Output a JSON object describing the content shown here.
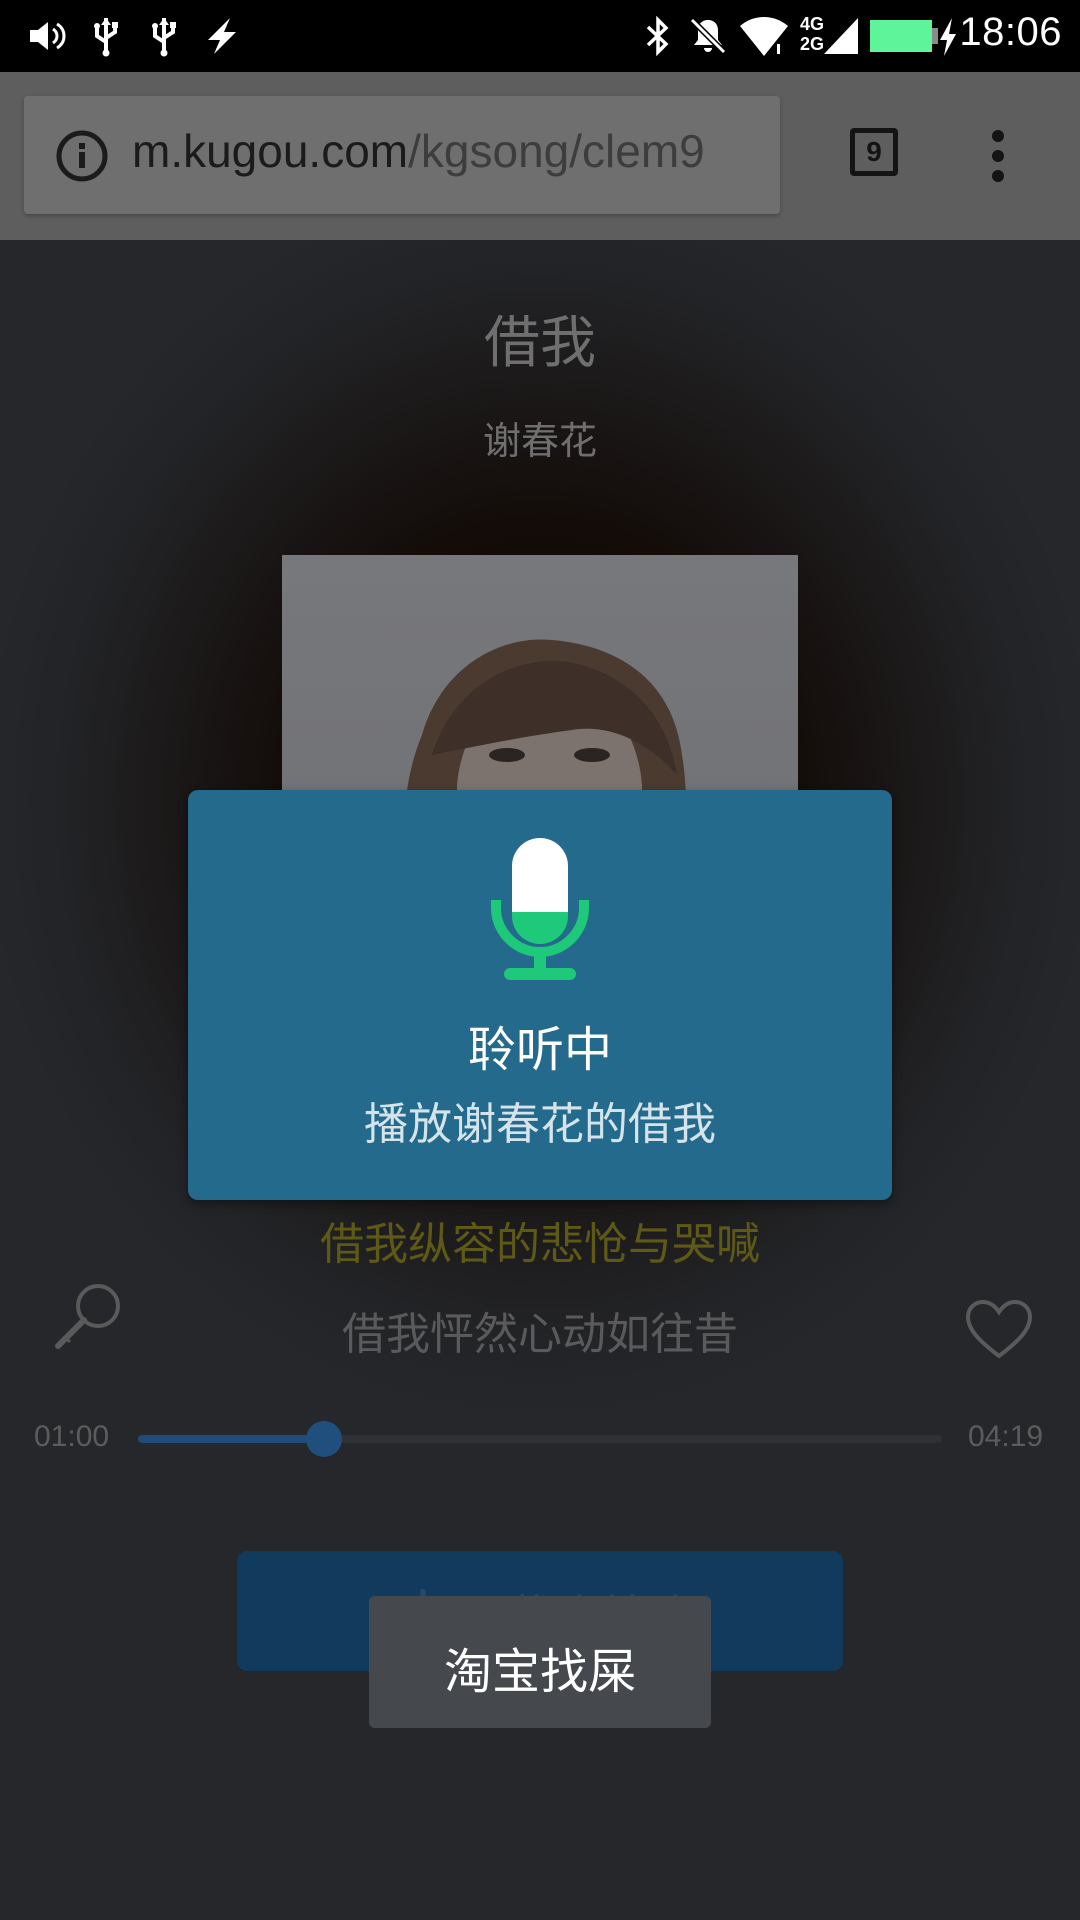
{
  "status_bar": {
    "left_icons": [
      "volume-icon",
      "usb-icon",
      "usb-icon",
      "flash-icon"
    ],
    "right_icons": [
      "bluetooth-icon",
      "notifications-off-icon",
      "wifi-icon",
      "signal-4g-2g-icon",
      "battery-charging-icon"
    ],
    "network_label_top": "4G",
    "network_label_bottom": "2G",
    "time": "18:06"
  },
  "browser": {
    "url_host": "m.kugou.com",
    "url_path": "/kgsong/clem9",
    "tab_count": "9"
  },
  "song": {
    "title": "借我",
    "artist": "谢春花"
  },
  "lyrics": {
    "current": "借我纵容的悲怆与哭喊",
    "next": "借我怦然心动如往昔"
  },
  "player": {
    "current_time": "01:00",
    "total_time": "04:19",
    "progress_fraction": 0.2317
  },
  "download": {
    "label": "下载这首歌"
  },
  "voice_dialog": {
    "status": "聆听中",
    "query": "播放谢春花的借我"
  },
  "toast": {
    "text": "淘宝找屎"
  },
  "colors": {
    "dialog_bg": "#246a8c",
    "mic_accent": "#1fc97a",
    "lyric_highlight": "#5e5a15"
  }
}
